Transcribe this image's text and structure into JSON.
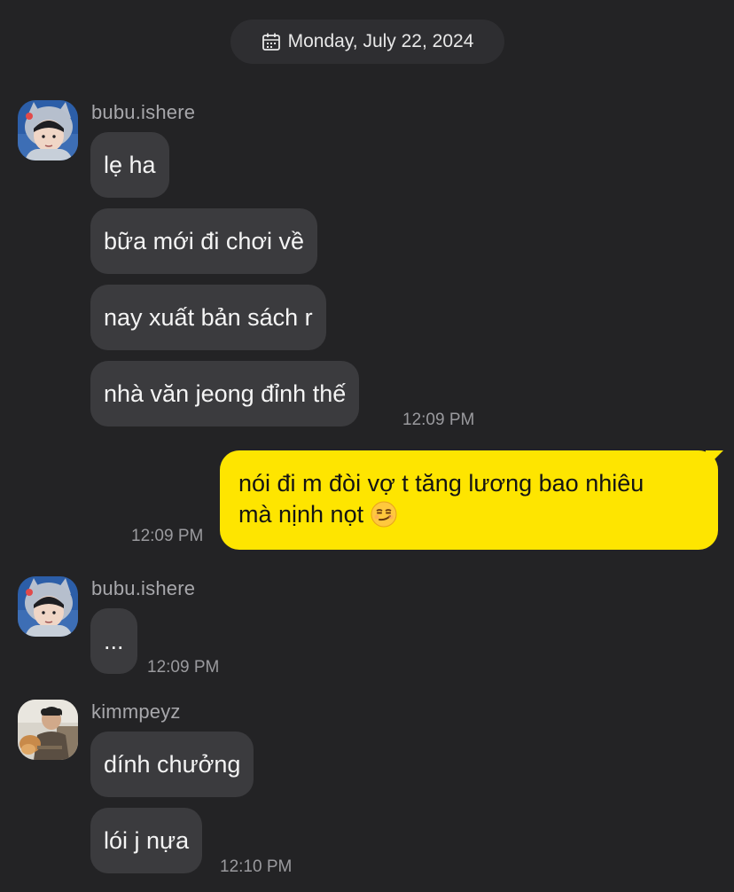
{
  "date_divider": {
    "label": "Monday, July 22, 2024",
    "icon": "calendar-icon"
  },
  "groups": [
    {
      "username": "bubu.ishere",
      "messages": [
        "lẹ ha",
        "bữa mới đi chơi về",
        "nay xuất bản sách r",
        "nhà văn jeong đỉnh thế"
      ],
      "time": "12:09 PM"
    },
    {
      "username": "bubu.ishere",
      "messages": [
        "..."
      ],
      "time": "12:09 PM"
    },
    {
      "username": "kimmpeyz",
      "messages": [
        "dính chưởng",
        "lói j nựa"
      ],
      "time": "12:10 PM"
    }
  ],
  "outgoing": {
    "line1": "nói đi m đòi vợ t tăng lương bao nhiêu",
    "line2": "mà nịnh nọt",
    "emoji": "smirking-face-emoji",
    "time": "12:09 PM"
  },
  "colors": {
    "background": "#232325",
    "incoming_bubble": "#3b3b3e",
    "outgoing_bubble": "#fee500"
  }
}
